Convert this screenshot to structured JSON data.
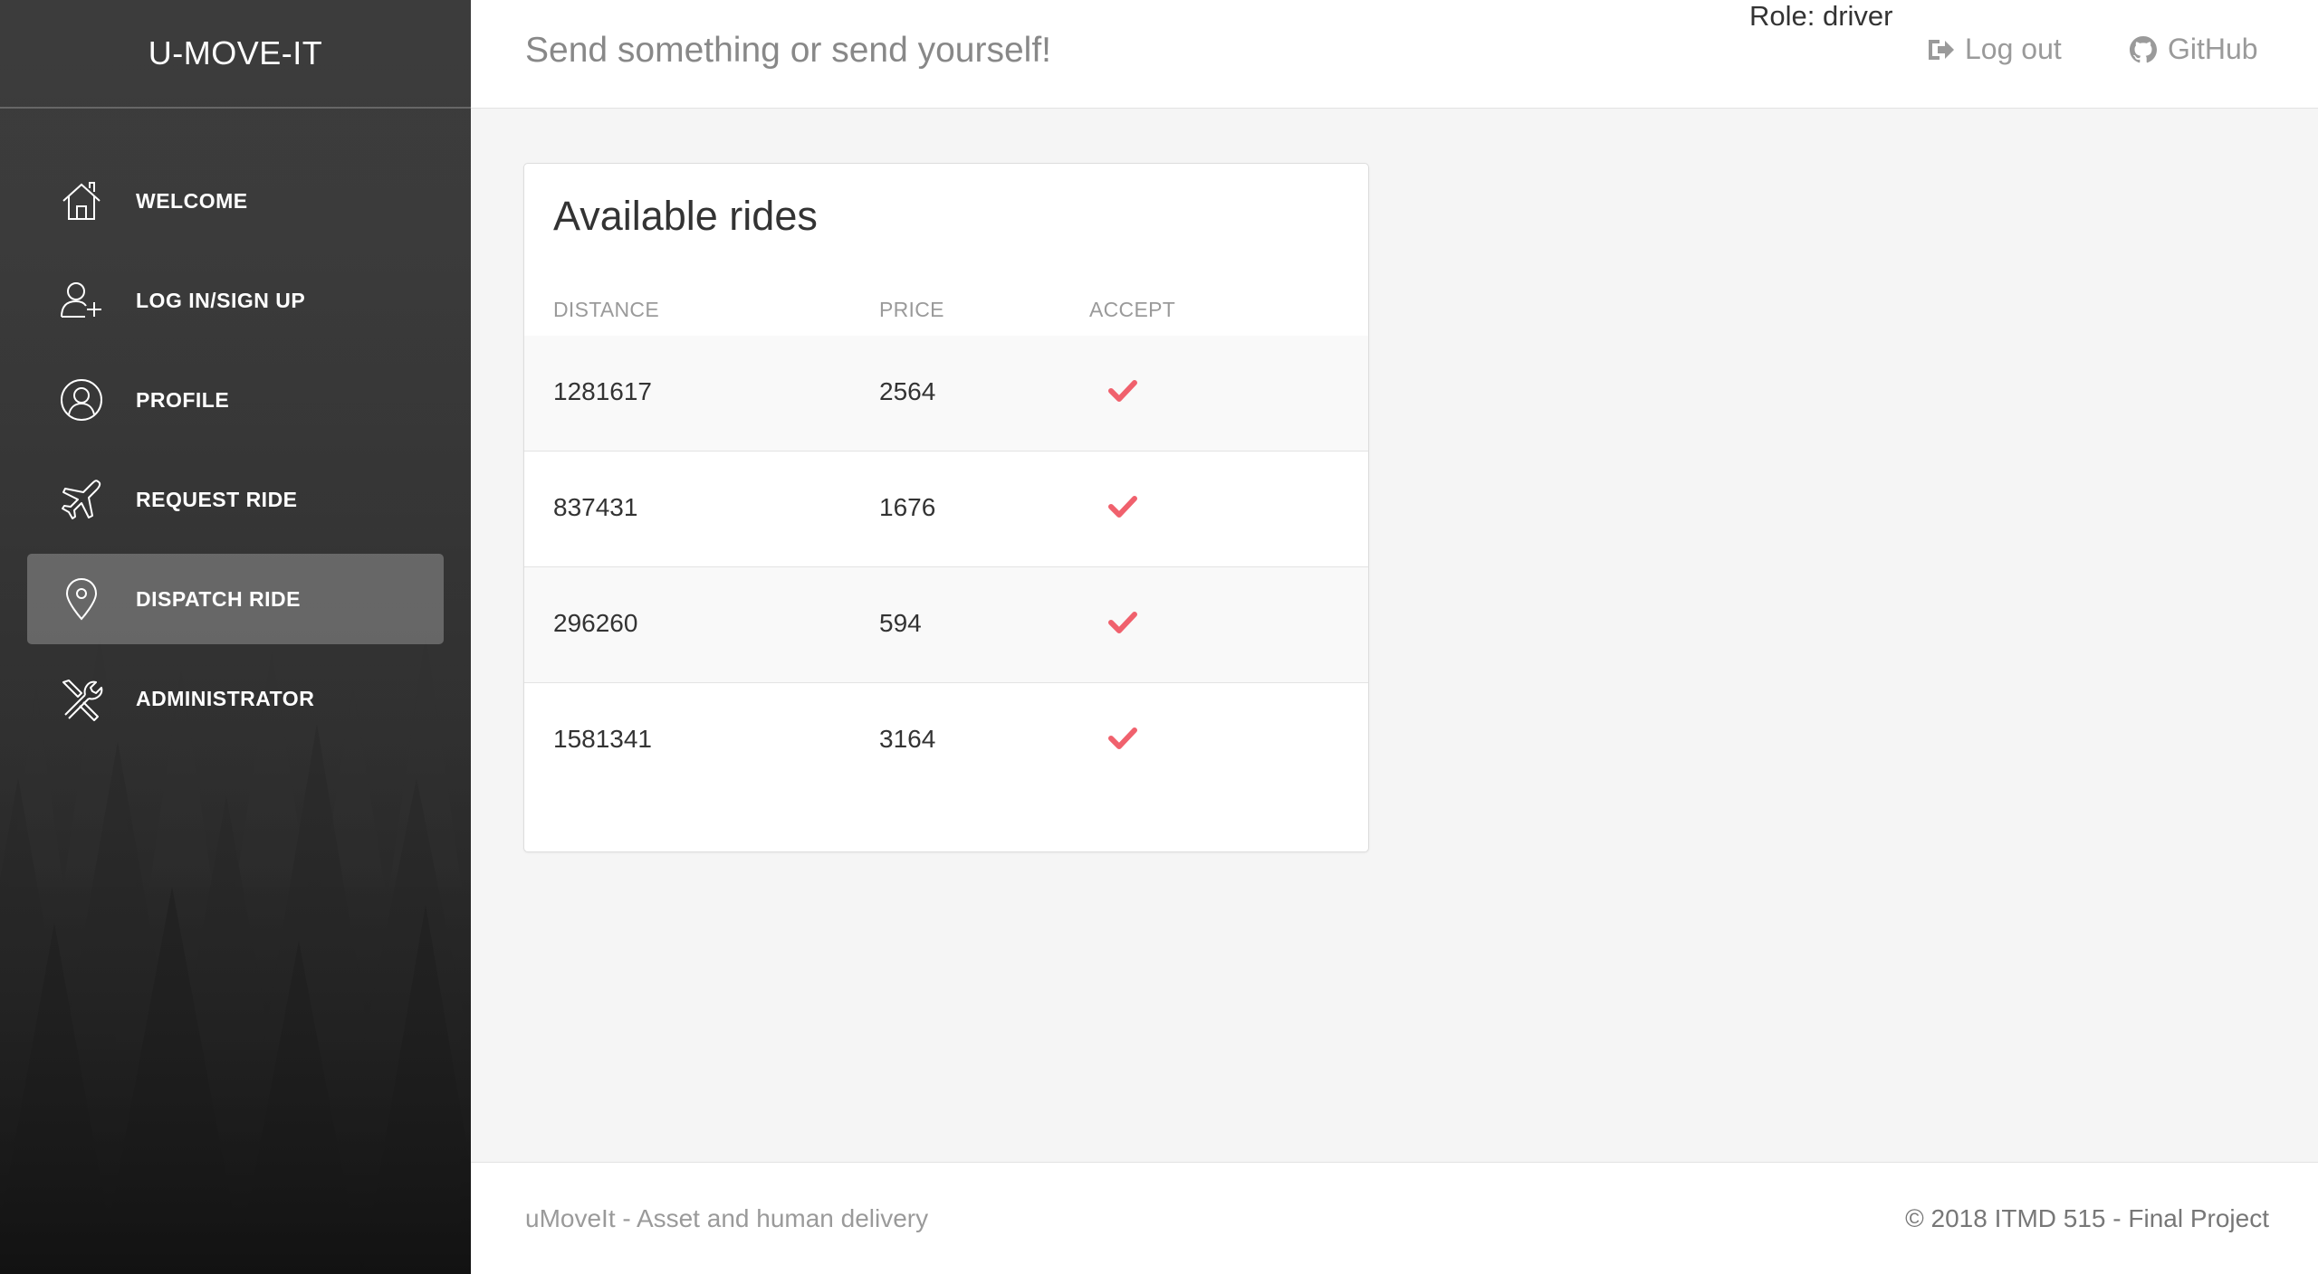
{
  "brand": "U-MOVE-IT",
  "sidebar": {
    "items": [
      {
        "label": "WELCOME",
        "icon": "home-icon",
        "active": false
      },
      {
        "label": "LOG IN/SIGN UP",
        "icon": "add-user-icon",
        "active": false
      },
      {
        "label": "PROFILE",
        "icon": "user-circle-icon",
        "active": false
      },
      {
        "label": "REQUEST RIDE",
        "icon": "airplane-icon",
        "active": false
      },
      {
        "label": "DISPATCH RIDE",
        "icon": "map-pin-icon",
        "active": true
      },
      {
        "label": "ADMINISTRATOR",
        "icon": "tools-icon",
        "active": false
      }
    ]
  },
  "header": {
    "title": "Send something or send yourself!",
    "role": "Role: driver",
    "logout_label": "Log out",
    "github_label": "GitHub"
  },
  "card": {
    "title": "Available rides",
    "columns": {
      "distance": "DISTANCE",
      "price": "PRICE",
      "accept": "ACCEPT"
    },
    "rows": [
      {
        "distance": "1281617",
        "price": "2564"
      },
      {
        "distance": "837431",
        "price": "1676"
      },
      {
        "distance": "296260",
        "price": "594"
      },
      {
        "distance": "1581341",
        "price": "3164"
      }
    ]
  },
  "footer": {
    "left": "uMoveIt - Asset and human delivery",
    "right": "© 2018 ITMD 515 - Final Project"
  },
  "colors": {
    "accent_check": "#f0616d",
    "sidebar_dark": "#2a2a2a",
    "active_item": "#6b6b6b"
  }
}
